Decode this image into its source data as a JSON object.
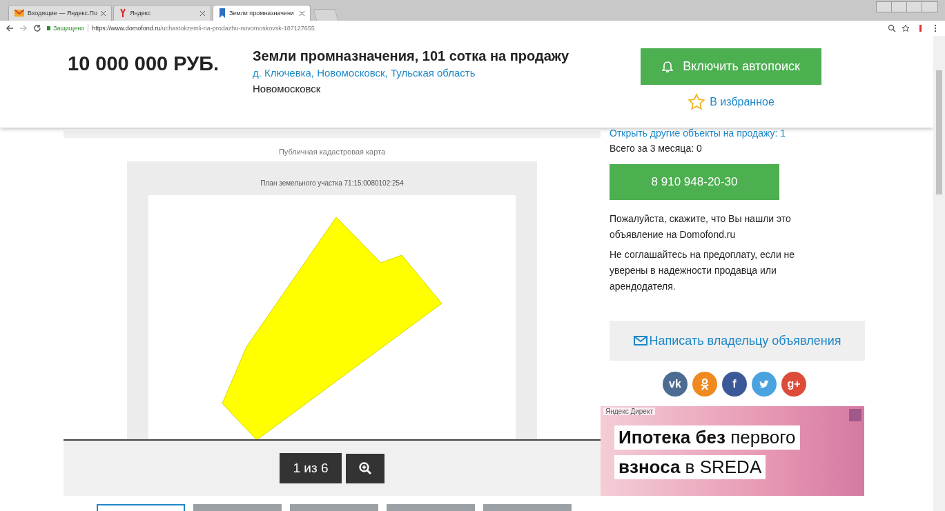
{
  "browser": {
    "tabs": [
      {
        "title": "Входящие — Яндекс.По",
        "kind": "mail",
        "selected": false
      },
      {
        "title": "Яндекс",
        "kind": "yandex",
        "selected": false
      },
      {
        "title": "Земли промназначени",
        "kind": "domofond",
        "selected": true
      }
    ],
    "secure_label": "Защищено",
    "url_host": "https://www.domofond.ru",
    "url_path": "/uchastokzemli-na-prodazhu-novomoskovsk-187127655"
  },
  "header": {
    "price": "10 000 000 РУБ.",
    "title": "Земли промназначения, 101 сотка на продажу",
    "address": "д. Ключевка, Новомосковск, Тульская область",
    "city": "Новомосковск",
    "autosearch_button": "Включить автопоиск",
    "favorite_link": "В избранное"
  },
  "gallery": {
    "map_title": "Публичная кадастровая карта",
    "plan_title": "План земельного участка 71:15:0080102:254",
    "counter": "1 из 6",
    "thumbnails": [
      {
        "selected": true
      },
      {
        "selected": false
      },
      {
        "selected": false
      },
      {
        "selected": false
      },
      {
        "selected": false
      }
    ]
  },
  "contact": {
    "other_objects": "Открыть другие объекты на продажу: 1",
    "total": "Всего за 3 месяца: 0",
    "phone_button": "8 910 948-20-30",
    "notes": [
      "Пожалуйста, скажите, что Вы нашли это объявление на Domofond.ru",
      "Не соглашайтесь на предоплату, если не уверены в надежности продавца или арендодателя."
    ],
    "write_button": "Написать владельцу объявления",
    "social": [
      {
        "kind": "vk",
        "label": "vk",
        "color": "#4c6c91"
      },
      {
        "kind": "ok",
        "color": "#f08a20"
      },
      {
        "kind": "facebook",
        "label": "f",
        "color": "#3b5998"
      },
      {
        "kind": "twitter",
        "color": "#4aa3df"
      },
      {
        "kind": "gplus",
        "label": "g+",
        "color": "#dd4b39"
      }
    ]
  },
  "ad": {
    "source": "Яндекс Директ",
    "lines": [
      "**Ипотека без** первого",
      "**взноса** в SREDA"
    ]
  }
}
